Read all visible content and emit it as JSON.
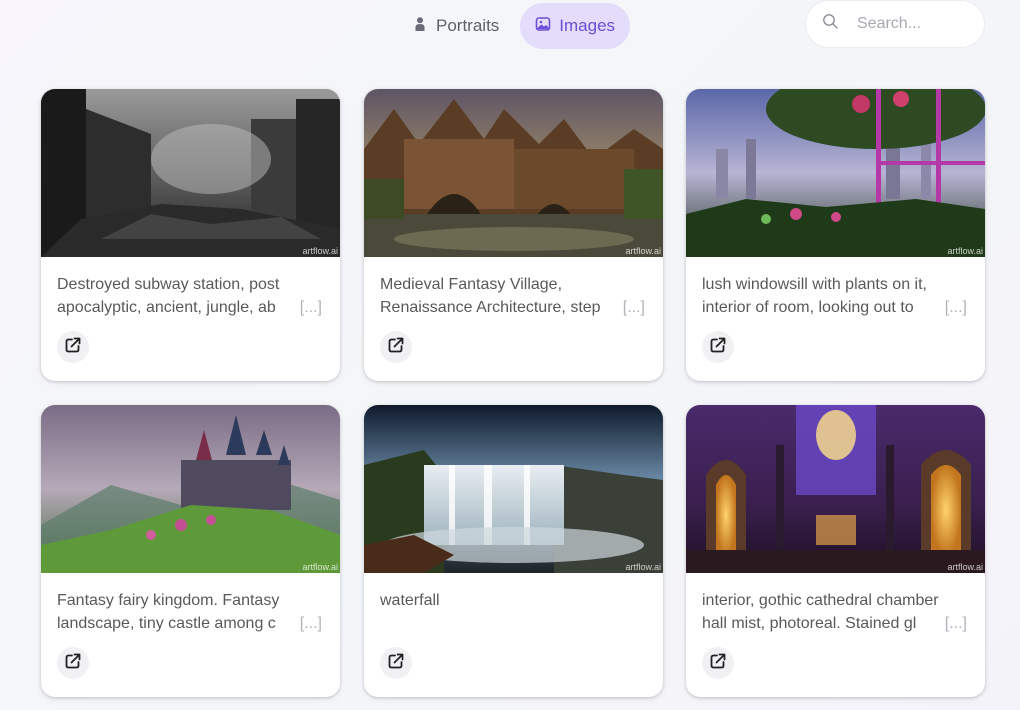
{
  "tabs": [
    {
      "label": "Portraits",
      "icon": "person-icon",
      "active": false
    },
    {
      "label": "Images",
      "icon": "image-icon",
      "active": true
    }
  ],
  "search": {
    "placeholder": "Search..."
  },
  "watermark": "artflow.ai",
  "more_label": "[...]",
  "cards": [
    {
      "line1": "Destroyed subway station, post",
      "line2": "apocalyptic, ancient, jungle, ab",
      "truncated": true
    },
    {
      "line1": "Medieval Fantasy Village,",
      "line2": "Renaissance Architecture, step",
      "truncated": true
    },
    {
      "line1": "lush windowsill with plants on it,",
      "line2": "interior of room, looking out to",
      "truncated": true
    },
    {
      "line1": "Fantasy fairy kingdom. Fantasy",
      "line2": "landscape, tiny castle among c",
      "truncated": true
    },
    {
      "line1": "waterfall",
      "line2": "",
      "truncated": false
    },
    {
      "line1": "interior, gothic cathedral chamber",
      "line2": "hall mist, photoreal. Stained gl",
      "truncated": true
    }
  ],
  "colors": {
    "accent": "#6b4fd6",
    "active_tab_bg": "#e4dcfb"
  }
}
